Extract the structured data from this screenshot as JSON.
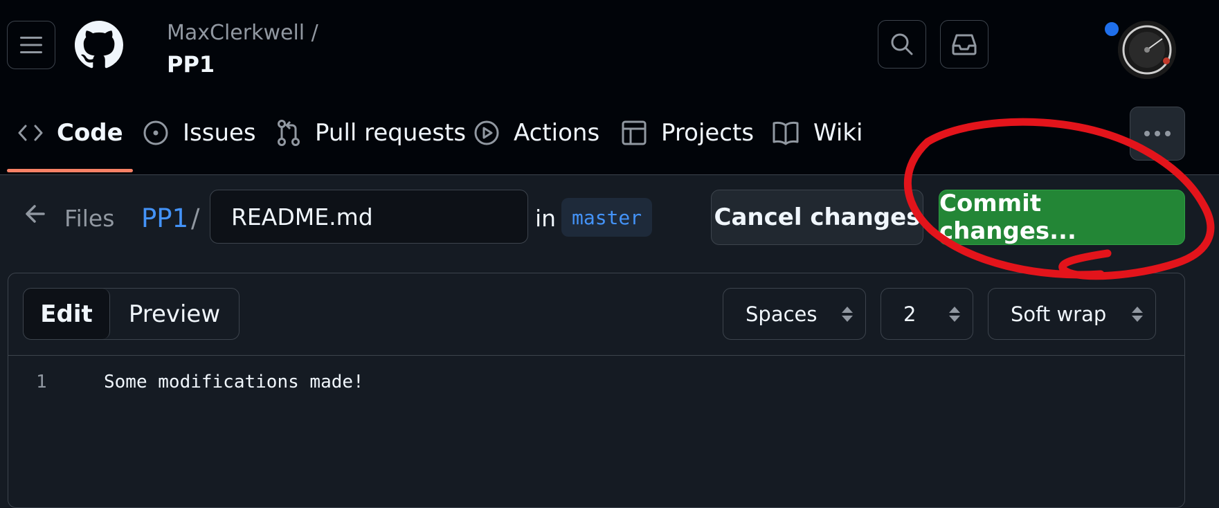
{
  "header": {
    "owner": "MaxClerkwell /",
    "repo": "PP1"
  },
  "nav": {
    "tabs": [
      {
        "label": "Code",
        "icon": "code-icon",
        "active": true
      },
      {
        "label": "Issues",
        "icon": "issue-opened-icon"
      },
      {
        "label": "Pull requests",
        "icon": "git-pull-request-icon"
      },
      {
        "label": "Actions",
        "icon": "play-icon"
      },
      {
        "label": "Projects",
        "icon": "table-icon"
      },
      {
        "label": "Wiki",
        "icon": "book-icon"
      }
    ]
  },
  "breadcrumb": {
    "back_label": "Files",
    "repo_link": "PP1",
    "separator": "/",
    "filename": "README.md",
    "in_label": "in",
    "branch": "master"
  },
  "actions": {
    "cancel_label": "Cancel changes",
    "commit_label": "Commit changes..."
  },
  "editor": {
    "tabs": [
      "Edit",
      "Preview"
    ],
    "indent_mode": "Spaces",
    "indent_size": "2",
    "wrap_mode": "Soft wrap",
    "lines": [
      {
        "number": "1",
        "text": "Some modifications made!"
      }
    ]
  },
  "colors": {
    "background": "#151b23",
    "header_background": "#010409",
    "accent_link": "#4493f8",
    "commit_green": "#238636",
    "active_tab_underline": "#f78166",
    "annotation_red": "#e3141b",
    "notification_dot": "#1f6feb"
  }
}
